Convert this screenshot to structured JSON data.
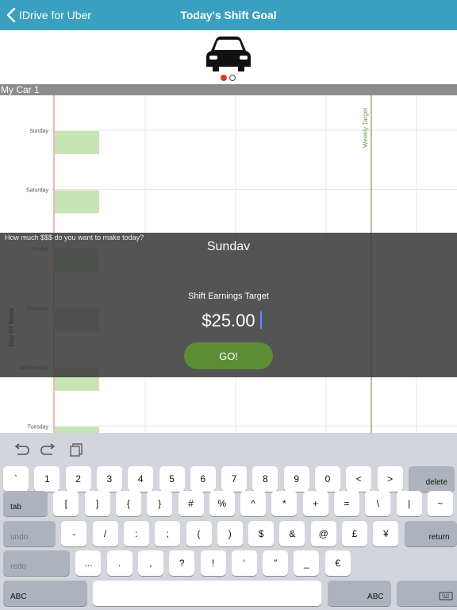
{
  "nav": {
    "back_label": "IDrive for Uber",
    "title": "Today's Shift Goal"
  },
  "car_selector": {
    "vehicle_name": "My Car 1",
    "page_count": 2,
    "active_page": 1
  },
  "chart_data": {
    "type": "bar",
    "orientation": "horizontal",
    "categories": [
      "Sunday",
      "Saturday",
      "Friday",
      "Thursday",
      "Wednesday",
      "Tuesday"
    ],
    "values": [
      25,
      25,
      25,
      25,
      25,
      25
    ],
    "ylabel": "Day Of Week",
    "annotations": [
      "Weekly Target"
    ],
    "grid": true,
    "colors": {
      "bar": "#c6e4b4",
      "target_line": "#7a9a5c",
      "left_line": "#e07070"
    }
  },
  "overlay": {
    "prompt": "How much $$$ do you want to make today?",
    "day": "Sundav",
    "target_label": "Shift Earnings Target",
    "amount_value": "$25.00",
    "go_label": "GO!"
  },
  "keyboard": {
    "rows": [
      [
        {
          "label": "`"
        },
        {
          "label": "1"
        },
        {
          "label": "2"
        },
        {
          "label": "3"
        },
        {
          "label": "4"
        },
        {
          "label": "5"
        },
        {
          "label": "6"
        },
        {
          "label": "7"
        },
        {
          "label": "8"
        },
        {
          "label": "9"
        },
        {
          "label": "0"
        },
        {
          "label": "<"
        },
        {
          "label": ">"
        },
        {
          "label": "delete",
          "fn": true
        }
      ],
      [
        {
          "label": "tab",
          "fn": true
        },
        {
          "label": "["
        },
        {
          "label": "]"
        },
        {
          "label": "{"
        },
        {
          "label": "}"
        },
        {
          "label": "#"
        },
        {
          "label": "%"
        },
        {
          "label": "^"
        },
        {
          "label": "*"
        },
        {
          "label": "+"
        },
        {
          "label": "="
        },
        {
          "label": "\\"
        },
        {
          "label": "|"
        },
        {
          "label": "~"
        }
      ],
      [
        {
          "label": "undo",
          "fn": true,
          "dim": true
        },
        {
          "label": "-"
        },
        {
          "label": "/"
        },
        {
          "label": ":"
        },
        {
          "label": ";"
        },
        {
          "label": "("
        },
        {
          "label": ")"
        },
        {
          "label": "$"
        },
        {
          "label": "&"
        },
        {
          "label": "@"
        },
        {
          "label": "£"
        },
        {
          "label": "¥"
        },
        {
          "label": "return",
          "fn": true
        }
      ],
      [
        {
          "label": "redo",
          "fn": true,
          "dim": true
        },
        {
          "label": "..."
        },
        {
          "label": "."
        },
        {
          "label": ","
        },
        {
          "label": "?"
        },
        {
          "label": "!"
        },
        {
          "label": "′"
        },
        {
          "label": "″"
        },
        {
          "label": "_"
        },
        {
          "label": "€"
        }
      ],
      [
        {
          "label": "ABC",
          "fn": true
        },
        {
          "label": "",
          "space": true
        },
        {
          "label": "ABC",
          "fn": true
        },
        {
          "label": "",
          "hide": true
        }
      ]
    ]
  }
}
